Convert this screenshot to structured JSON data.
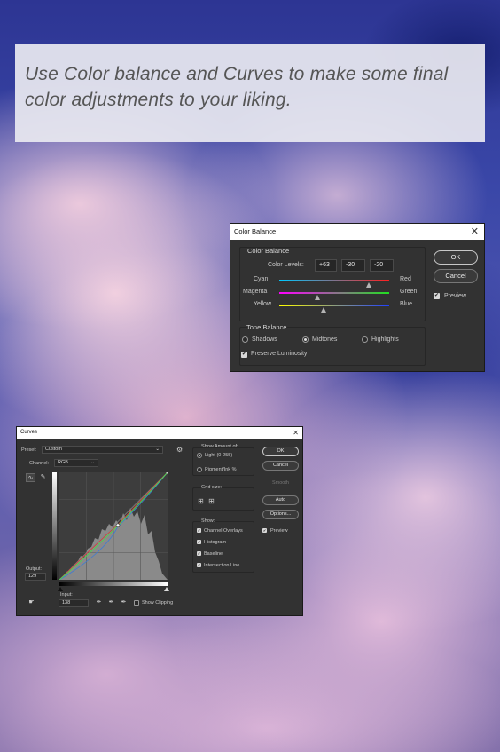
{
  "caption": {
    "line1": "Use Color balance and Curves to make some final",
    "line2": "color adjustments to your liking."
  },
  "color_balance": {
    "title": "Color Balance",
    "close_icon": "close-icon",
    "group_title": "Color Balance",
    "levels_label": "Color Levels:",
    "levels": [
      "+63",
      "-30",
      "-20"
    ],
    "sliders": [
      {
        "left": "Cyan",
        "right": "Red",
        "value": 63,
        "colors": [
          "#00c8ff",
          "#ff2020"
        ]
      },
      {
        "left": "Magenta",
        "right": "Green",
        "value": -30,
        "colors": [
          "#ff00ff",
          "#20e020"
        ]
      },
      {
        "left": "Yellow",
        "right": "Blue",
        "value": -20,
        "colors": [
          "#ffff00",
          "#2040ff"
        ]
      }
    ],
    "tone_title": "Tone Balance",
    "tones": [
      "Shadows",
      "Midtones",
      "Highlights"
    ],
    "tone_selected": "Midtones",
    "preserve_luminosity": "Preserve Luminosity",
    "preserve_checked": true,
    "ok": "OK",
    "cancel": "Cancel",
    "preview": "Preview",
    "preview_checked": true
  },
  "curves": {
    "title": "Curves",
    "preset_label": "Preset:",
    "preset_value": "Custom",
    "channel_label": "Channel:",
    "channel_value": "RGB",
    "output_label": "Output:",
    "output_value": "129",
    "input_label": "Input:",
    "input_value": "138",
    "show_clipping": "Show Clipping",
    "show_amount_title": "Show Amount of:",
    "light": "Light  (0-255)",
    "pigment": "Pigment/Ink %",
    "grid_size_title": "Grid size:",
    "show_title": "Show:",
    "show_options": [
      "Channel Overlays",
      "Histogram",
      "Baseline",
      "Intersection Line"
    ],
    "ok": "OK",
    "cancel": "Cancel",
    "smooth": "Smooth",
    "auto": "Auto",
    "options": "Options...",
    "preview": "Preview",
    "curve_point": {
      "input": 138,
      "output": 129
    }
  }
}
